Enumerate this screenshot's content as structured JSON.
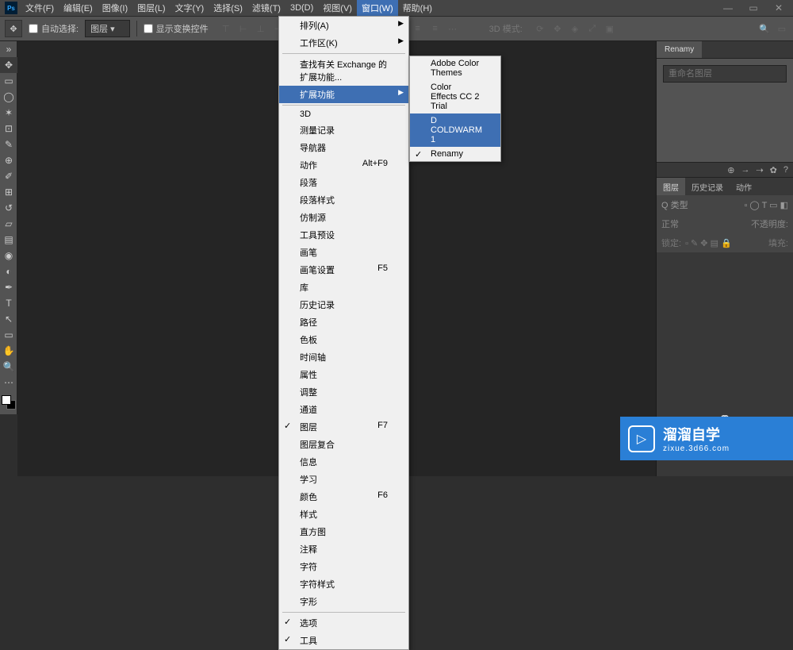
{
  "app_icon_label": "Ps",
  "menubar": [
    "文件(F)",
    "编辑(E)",
    "图像(I)",
    "图层(L)",
    "文字(Y)",
    "选择(S)",
    "滤镜(T)",
    "3D(D)",
    "视图(V)",
    "窗口(W)",
    "帮助(H)"
  ],
  "menubar_active_index": 9,
  "options": {
    "auto_select": "自动选择:",
    "layer_select": "图层",
    "show_transform": "显示变换控件",
    "mode_label": "3D 模式:"
  },
  "window_menu": {
    "items": [
      {
        "label": "排列(A)",
        "arrow": true
      },
      {
        "label": "工作区(K)",
        "arrow": true
      },
      {
        "sep": true
      },
      {
        "label": "查找有关 Exchange 的扩展功能..."
      },
      {
        "label": "扩展功能",
        "arrow": true,
        "highlight": true
      },
      {
        "sep": true
      },
      {
        "label": "3D"
      },
      {
        "label": "测量记录"
      },
      {
        "label": "导航器"
      },
      {
        "label": "动作",
        "shortcut": "Alt+F9"
      },
      {
        "label": "段落"
      },
      {
        "label": "段落样式"
      },
      {
        "label": "仿制源"
      },
      {
        "label": "工具预设"
      },
      {
        "label": "画笔"
      },
      {
        "label": "画笔设置",
        "shortcut": "F5"
      },
      {
        "label": "库"
      },
      {
        "label": "历史记录"
      },
      {
        "label": "路径"
      },
      {
        "label": "色板"
      },
      {
        "label": "时间轴"
      },
      {
        "label": "属性"
      },
      {
        "label": "调整"
      },
      {
        "label": "通道"
      },
      {
        "label": "图层",
        "shortcut": "F7",
        "check": true
      },
      {
        "label": "图层复合"
      },
      {
        "label": "信息"
      },
      {
        "label": "学习"
      },
      {
        "label": "颜色",
        "shortcut": "F6"
      },
      {
        "label": "样式"
      },
      {
        "label": "直方图"
      },
      {
        "label": "注释"
      },
      {
        "label": "字符"
      },
      {
        "label": "字符样式"
      },
      {
        "label": "字形"
      },
      {
        "sep": true
      },
      {
        "label": "选项",
        "check": true
      },
      {
        "label": "工具",
        "check": true
      }
    ]
  },
  "submenu": {
    "items": [
      {
        "label": "Adobe Color Themes"
      },
      {
        "label": "Color Effects CC 2 Trial"
      },
      {
        "label": "D COLDWARM 1",
        "highlight": true
      },
      {
        "label": "Renamy",
        "check": true
      }
    ]
  },
  "panels": {
    "renamy_tab": "Renamy",
    "renamy_placeholder": "重命名图层",
    "layers_tabs": [
      "图层",
      "历史记录",
      "动作"
    ],
    "kind": "Q 类型",
    "blend_mode": "正常",
    "opacity_label": "不透明度:",
    "lock_label": "锁定:",
    "fill_label": "填充:"
  },
  "watermark": {
    "title": "溜溜自学",
    "url": "zixue.3d66.com"
  }
}
